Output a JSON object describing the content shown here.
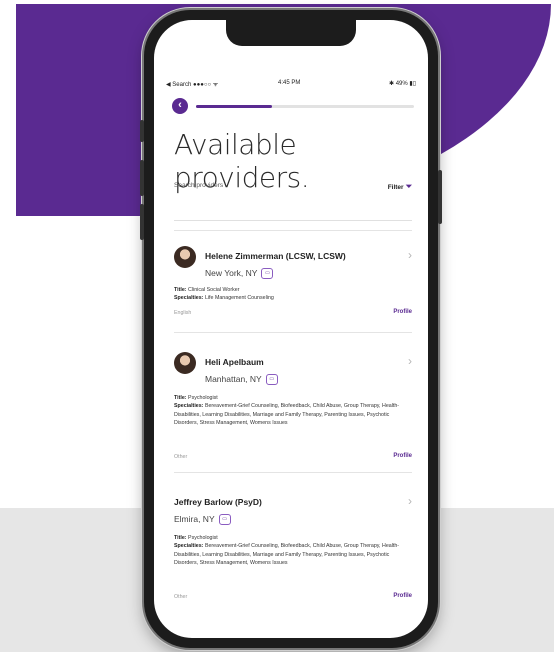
{
  "status_bar": {
    "carrier": "◀ Search ●●●○○ ᯤ",
    "time": "4:45 PM",
    "battery": "✱ 49% ▮▯"
  },
  "nav": {
    "back_icon": "chevron-left",
    "progress_fraction": 0.35
  },
  "page": {
    "title": "Available providers.",
    "search_placeholder": "Search providers",
    "filter_label": "Filter",
    "filter_icon": "funnel"
  },
  "providers": [
    {
      "name": "Helene Zimmerman (LCSW, LCSW)",
      "location": "New York, NY",
      "title_label": "Title:",
      "title": "Clinical Social Worker",
      "specialties_label": "Specialties:",
      "specialties": "Life Management Counseling",
      "language": "English",
      "profile_label": "Profile"
    },
    {
      "name": "Heli Apelbaum",
      "location": "Manhattan, NY",
      "title_label": "Title:",
      "title": "Psychologist",
      "specialties_label": "Specialties:",
      "specialties": "Bereavement-Grief Counseling, Biofeedback, Child Abuse, Group Therapy, Health-Disabilities, Learning Disabilities, Marriage and Family Therapy, Parenting Issues, Psychotic Disorders, Stress Management, Womens Issues",
      "language": "Other",
      "profile_label": "Profile"
    },
    {
      "name": "Jeffrey Barlow (PsyD)",
      "location": "Elmira, NY",
      "title_label": "Title:",
      "title": "Psychologist",
      "specialties_label": "Specialties:",
      "specialties": "Bereavement-Grief Counseling, Biofeedback, Child Abuse, Group Therapy, Health-Disabilities, Learning Disabilities, Marriage and Family Therapy, Parenting Issues, Psychotic Disorders, Stress Management, Womens Issues",
      "language": "Other",
      "profile_label": "Profile"
    }
  ],
  "colors": {
    "brand_purple": "#5a2a91",
    "background_grey": "#e6e6e6"
  }
}
